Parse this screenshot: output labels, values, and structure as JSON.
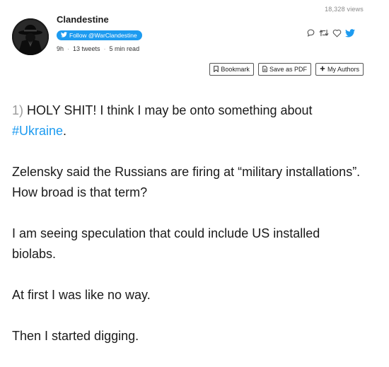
{
  "header": {
    "views": "18,328 views",
    "author_name": "Clandestine",
    "follow_label": "Follow @WarClandestine",
    "meta": {
      "time": "9h",
      "tweets": "13 tweets",
      "read_time": "5 min read"
    },
    "separator": "·"
  },
  "icons": {
    "reply": "reply-icon",
    "retweet": "retweet-icon",
    "like": "heart-icon",
    "twitter": "twitter-bird-icon"
  },
  "toolbar": {
    "bookmark_label": "Bookmark",
    "save_pdf_label": "Save as PDF",
    "my_authors_label": "My Authors"
  },
  "thread": {
    "first_number": "1)",
    "p1_text": " HOLY SHIT! I think I may be onto something about",
    "p1_hashtag": "#Ukraine",
    "p1_end": ".",
    "p2": "Zelensky said the Russians are firing at “military installations”. How broad is that term?",
    "p3": "I am seeing speculation that could include US installed biolabs.",
    "p4": "At first I was like no way.",
    "p5": "Then I started digging."
  },
  "colors": {
    "accent": "#1d9bf0",
    "muted": "#9a9a9a"
  }
}
